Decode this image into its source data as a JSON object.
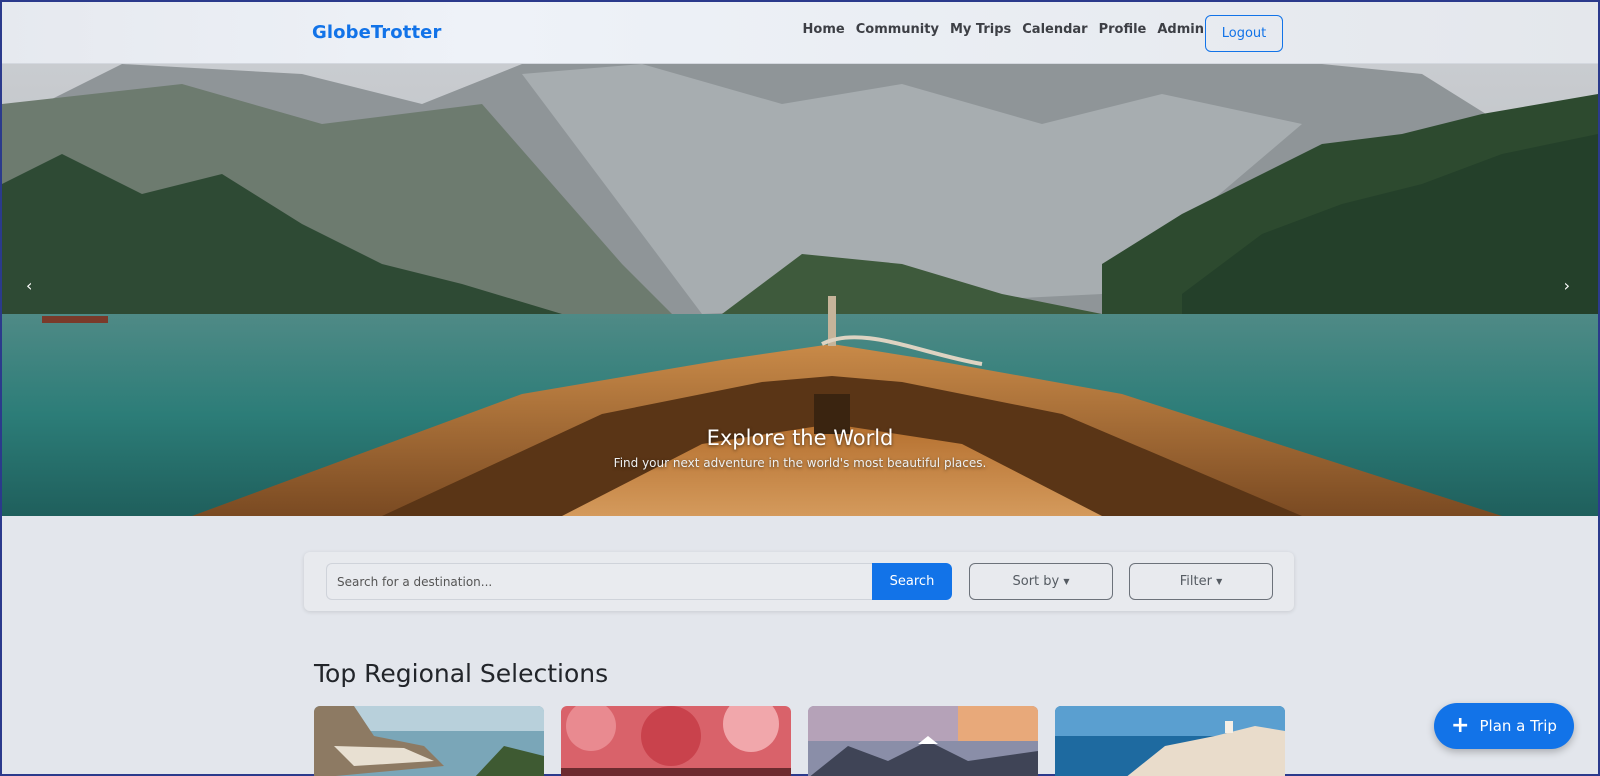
{
  "brand": "GlobeTrotter",
  "nav": {
    "links": [
      "Home",
      "Community",
      "My Trips",
      "Calendar",
      "Profile",
      "Admin"
    ],
    "logout_label": "Logout"
  },
  "hero": {
    "title": "Explore the World",
    "subtitle": "Find your next adventure in the world's most beautiful places.",
    "prev_icon": "chevron-left-icon",
    "next_icon": "chevron-right-icon",
    "prev_glyph": "‹",
    "next_glyph": "›"
  },
  "search": {
    "placeholder": "Search for a destination...",
    "value": "",
    "button_label": "Search",
    "sort_label": "Sort by",
    "filter_label": "Filter"
  },
  "section": {
    "title": "Top Regional Selections"
  },
  "fab": {
    "label": "Plan a Trip",
    "icon": "plus-icon",
    "glyph": "+"
  },
  "colors": {
    "accent": "#1273e8",
    "text": "#22252a",
    "background": "#e3e6ec"
  }
}
